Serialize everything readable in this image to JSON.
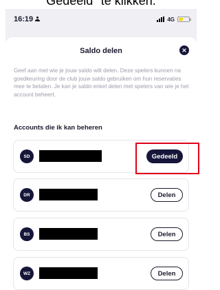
{
  "caption": "Gedeeld\" te klikken.",
  "status_bar": {
    "time": "16:19",
    "network": "4G",
    "battery_fill": 0.4,
    "battery_color": "#f5d90a"
  },
  "sheet": {
    "title": "Saldo delen",
    "description": "Geef aan met wie je jouw saldo wilt delen. Deze spelers kunnen na goedkeuring door de club jouw saldo gebruiken om hun reservaties mee te betalen. Je kan je saldo enkel delen met spelers van wie je het account beheert.",
    "section_title": "Accounts die ik kan beheren"
  },
  "accounts": [
    {
      "initials": "SD",
      "action_label": "Gedeeld",
      "state": "shared",
      "highlighted": true
    },
    {
      "initials": "DR",
      "action_label": "Delen",
      "state": "not-shared",
      "highlighted": false
    },
    {
      "initials": "BS",
      "action_label": "Delen",
      "state": "not-shared",
      "highlighted": false
    },
    {
      "initials": "WZ",
      "action_label": "Delen",
      "state": "not-shared",
      "highlighted": false
    }
  ],
  "colors": {
    "brand_dark": "#16163a",
    "muted_text": "#9c9cae",
    "highlight_red": "#e0001b"
  },
  "icons": {
    "close": "close-icon",
    "signal": "signal-icon",
    "battery": "battery-icon",
    "person": "person-icon"
  }
}
